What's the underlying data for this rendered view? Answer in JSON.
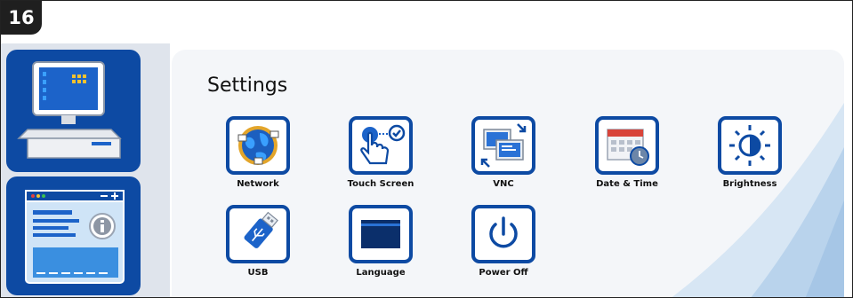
{
  "step_number": "16",
  "screen": {
    "title": "Settings"
  },
  "sidebar": {
    "items": [
      {
        "icon": "pos-terminal-icon"
      },
      {
        "icon": "info-window-icon"
      }
    ]
  },
  "apps": [
    {
      "label": "Network",
      "icon": "network-globe-icon"
    },
    {
      "label": "Touch Screen",
      "icon": "touch-screen-icon"
    },
    {
      "label": "VNC",
      "icon": "vnc-icon"
    },
    {
      "label": "Date & Time",
      "icon": "calendar-clock-icon"
    },
    {
      "label": "Brightness",
      "icon": "brightness-icon"
    },
    {
      "label": "USB",
      "icon": "usb-drive-icon"
    },
    {
      "label": "Language",
      "icon": "folder-icon"
    },
    {
      "label": "Power Off",
      "icon": "power-icon"
    }
  ],
  "colors": {
    "brand_blue": "#0d4aa3",
    "badge_bg": "#1f1f1f",
    "panel_bg": "#f4f6f9"
  }
}
